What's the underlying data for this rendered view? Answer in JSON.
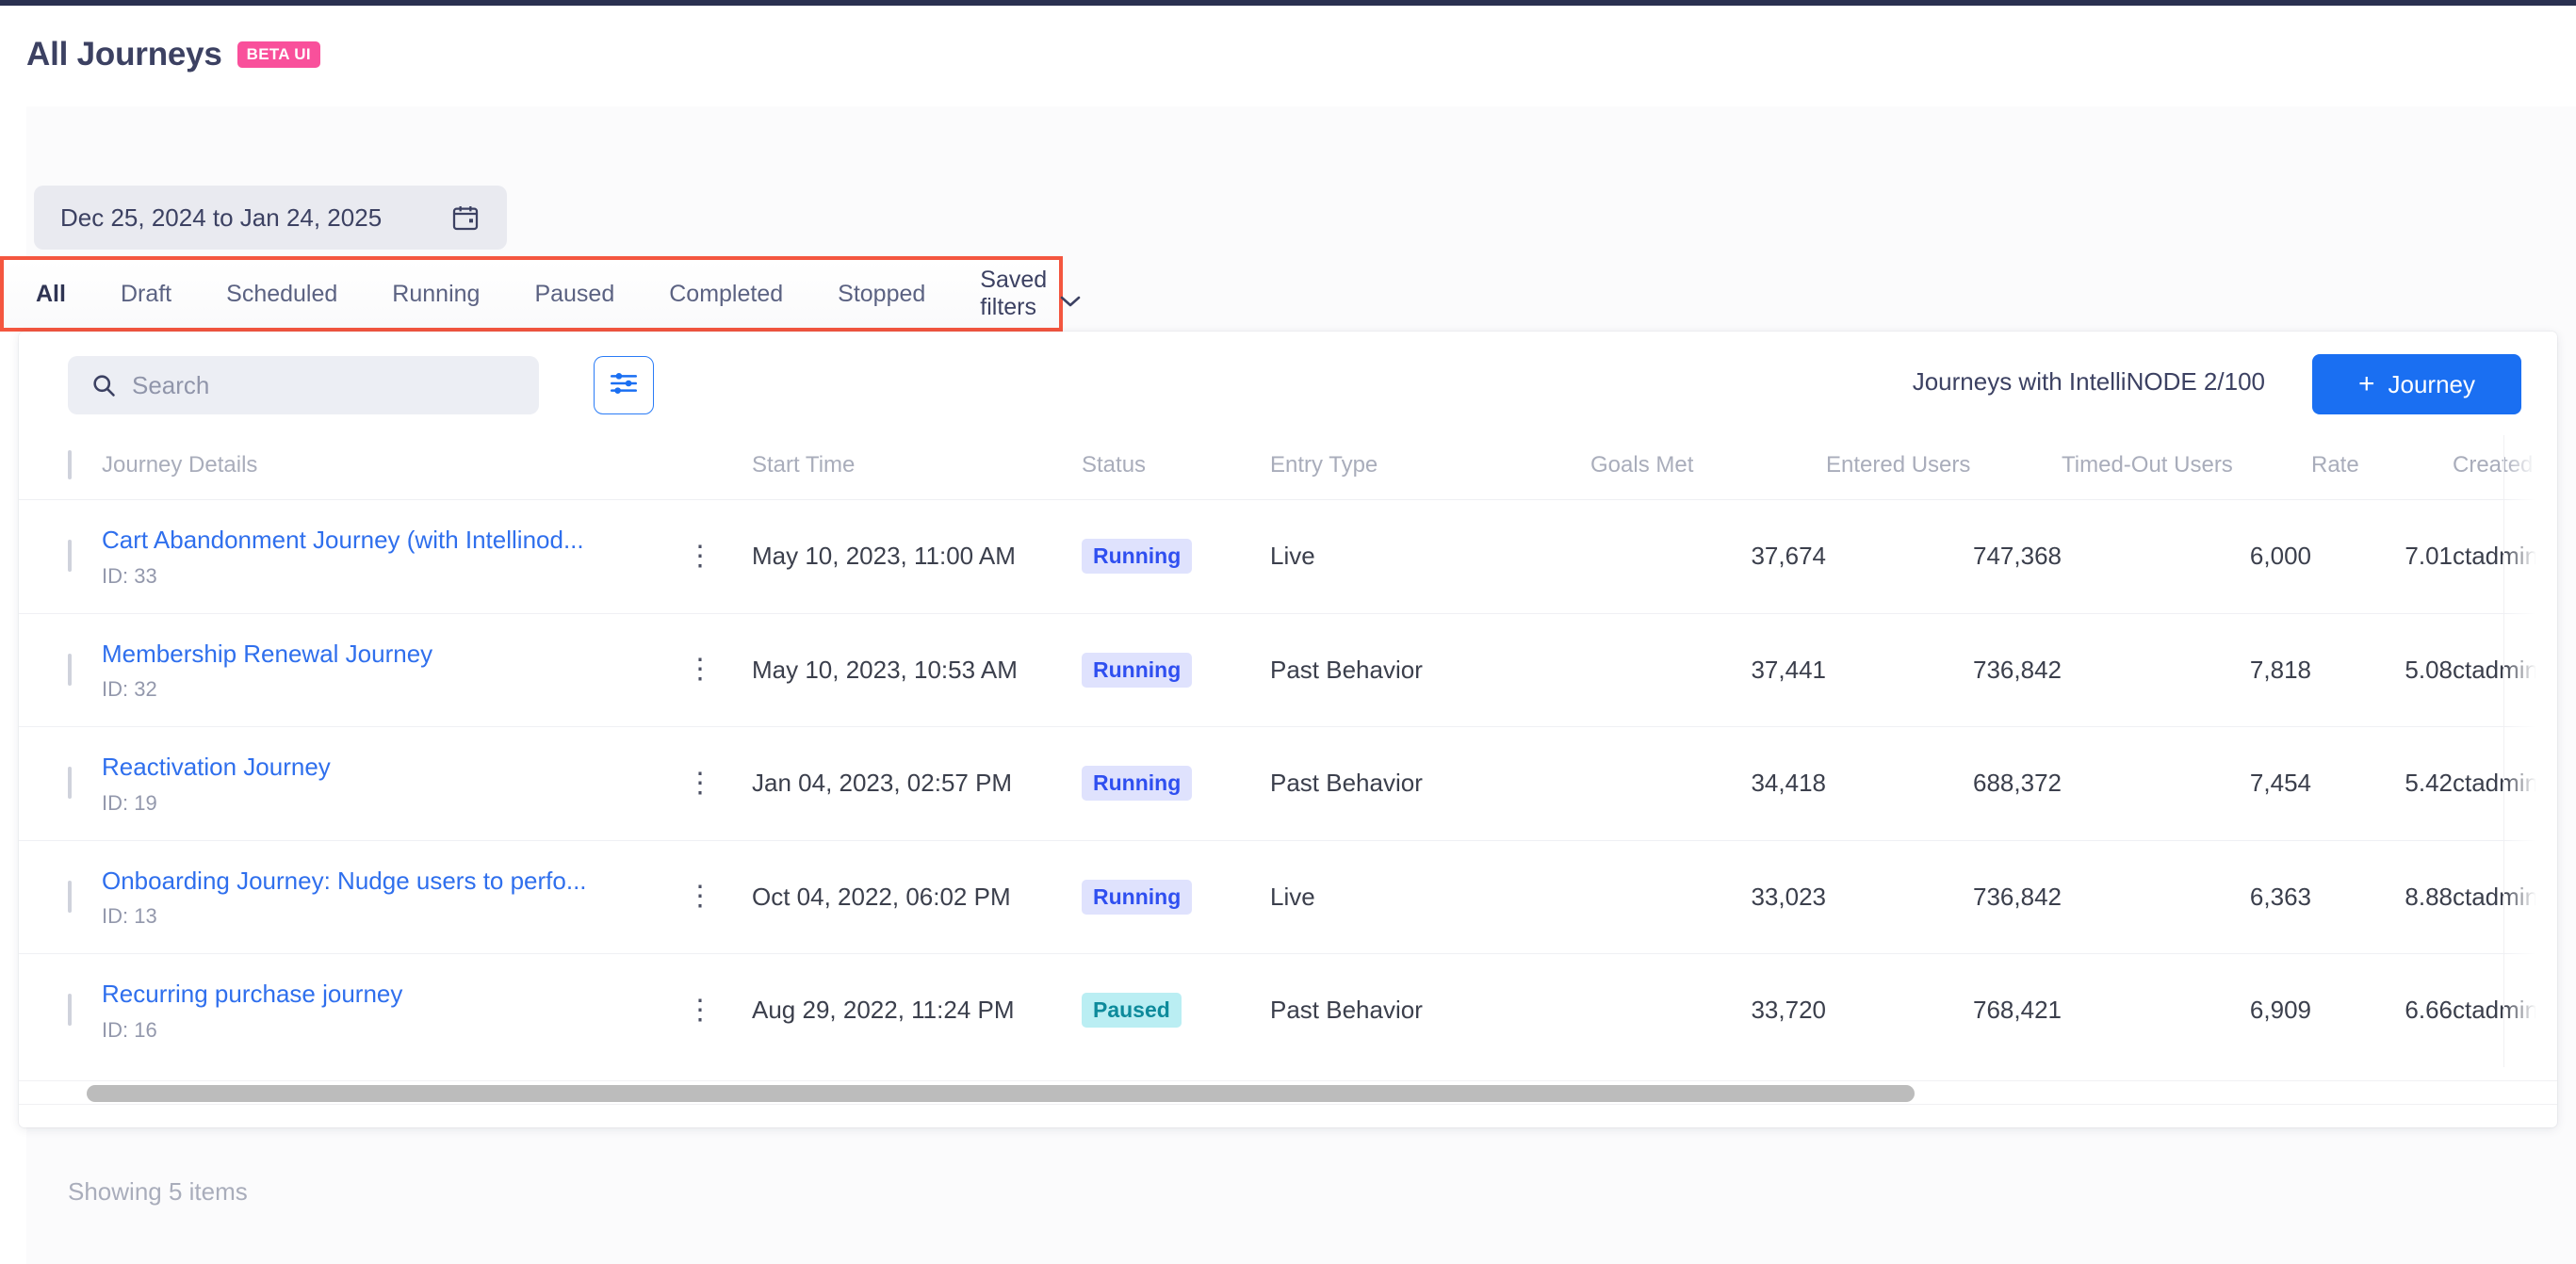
{
  "header": {
    "title": "All Journeys",
    "beta_badge": "BETA UI"
  },
  "date_range": {
    "value": "Dec 25, 2024 to Jan 24, 2025",
    "icon": "calendar-icon"
  },
  "filter_tabs": {
    "items": [
      {
        "label": "All",
        "active": true
      },
      {
        "label": "Draft",
        "active": false
      },
      {
        "label": "Scheduled",
        "active": false
      },
      {
        "label": "Running",
        "active": false
      },
      {
        "label": "Paused",
        "active": false
      },
      {
        "label": "Completed",
        "active": false
      },
      {
        "label": "Stopped",
        "active": false
      }
    ],
    "saved_filters_label": "Saved filters",
    "highlight_color": "#f4563f"
  },
  "toolbar": {
    "search_placeholder": "Search",
    "search_value": "",
    "search_icon": "search-icon",
    "filter_icon": "sliders-icon",
    "intellinode_text": "Journeys with IntelliNODE 2/100",
    "add_button_label": "Journey",
    "add_button_plus": "+",
    "accent_color": "#1a6ff2"
  },
  "table": {
    "columns": [
      "Journey Details",
      "Start Time",
      "Status",
      "Entry Type",
      "Goals Met",
      "Entered Users",
      "Timed-Out Users",
      "Rate",
      "Created By"
    ],
    "rows": [
      {
        "name": "Cart Abandonment Journey (with Intellinod...",
        "id": "ID: 33",
        "start_time": "May 10, 2023, 11:00 AM",
        "status": "Running",
        "status_kind": "running",
        "entry_type": "Live",
        "goals_met": "37,674",
        "entered_users": "747,368",
        "timed_out_users": "6,000",
        "rate": "7.01",
        "created_by": "ctadmin@cleverta"
      },
      {
        "name": "Membership Renewal Journey",
        "id": "ID: 32",
        "start_time": "May 10, 2023, 10:53 AM",
        "status": "Running",
        "status_kind": "running",
        "entry_type": "Past Behavior",
        "goals_met": "37,441",
        "entered_users": "736,842",
        "timed_out_users": "7,818",
        "rate": "5.08",
        "created_by": "ctadmin@cleverta"
      },
      {
        "name": "Reactivation Journey",
        "id": "ID: 19",
        "start_time": "Jan 04, 2023, 02:57 PM",
        "status": "Running",
        "status_kind": "running",
        "entry_type": "Past Behavior",
        "goals_met": "34,418",
        "entered_users": "688,372",
        "timed_out_users": "7,454",
        "rate": "5.42",
        "created_by": "ctadmin@cleverta"
      },
      {
        "name": "Onboarding Journey: Nudge users to perfo...",
        "id": "ID: 13",
        "start_time": "Oct 04, 2022, 06:02 PM",
        "status": "Running",
        "status_kind": "running",
        "entry_type": "Live",
        "goals_met": "33,023",
        "entered_users": "736,842",
        "timed_out_users": "6,363",
        "rate": "8.88",
        "created_by": "ctadmin@cleverta"
      },
      {
        "name": "Recurring purchase journey",
        "id": "ID: 16",
        "start_time": "Aug 29, 2022, 11:24 PM",
        "status": "Paused",
        "status_kind": "paused",
        "entry_type": "Past Behavior",
        "goals_met": "33,720",
        "entered_users": "768,421",
        "timed_out_users": "6,909",
        "rate": "6.66",
        "created_by": "ctadmin@cleverta"
      }
    ]
  },
  "footer": {
    "count_text": "Showing 5 items"
  }
}
